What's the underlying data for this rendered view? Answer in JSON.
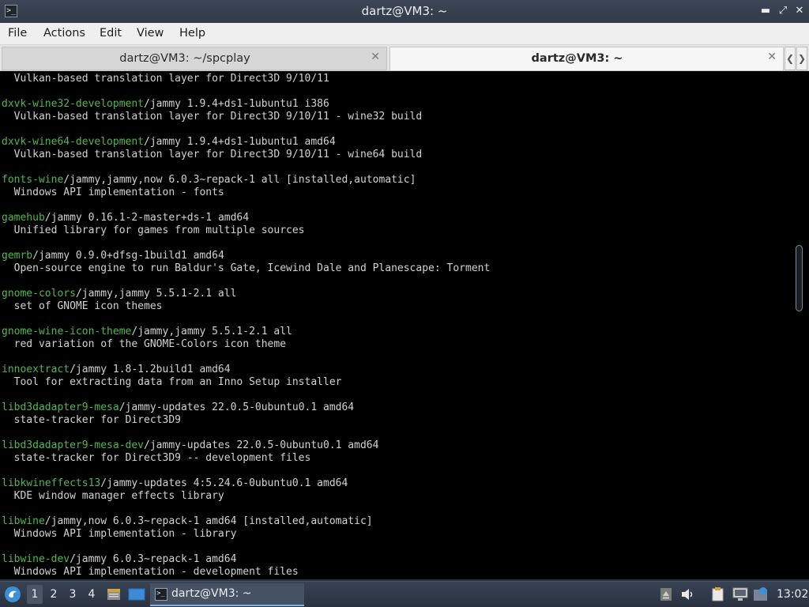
{
  "window": {
    "title": "dartz@VM3: ~",
    "app_icon_glyph": ">_",
    "buttons": {
      "minimize": "▬",
      "maximize": "⤢",
      "close": "✕"
    }
  },
  "menu": [
    "File",
    "Actions",
    "Edit",
    "View",
    "Help"
  ],
  "tabs": [
    {
      "label": "dartz@VM3: ~/spcplay",
      "active": false
    },
    {
      "label": "dartz@VM3: ~",
      "active": true
    }
  ],
  "tab_close_glyph": "✕",
  "tab_nav": {
    "prev": "❮",
    "next": "❯"
  },
  "terminal_lines": [
    {
      "pkg": "",
      "rest": "  Vulkan-based translation layer for Direct3D 9/10/11"
    },
    {
      "pkg": "",
      "rest": ""
    },
    {
      "pkg": "dxvk-wine32-development",
      "rest": "/jammy 1.9.4+ds1-1ubuntu1 i386"
    },
    {
      "pkg": "",
      "rest": "  Vulkan-based translation layer for Direct3D 9/10/11 - wine32 build"
    },
    {
      "pkg": "",
      "rest": ""
    },
    {
      "pkg": "dxvk-wine64-development",
      "rest": "/jammy 1.9.4+ds1-1ubuntu1 amd64"
    },
    {
      "pkg": "",
      "rest": "  Vulkan-based translation layer for Direct3D 9/10/11 - wine64 build"
    },
    {
      "pkg": "",
      "rest": ""
    },
    {
      "pkg": "fonts-wine",
      "rest": "/jammy,jammy,now 6.0.3~repack-1 all [installed,automatic]"
    },
    {
      "pkg": "",
      "rest": "  Windows API implementation - fonts"
    },
    {
      "pkg": "",
      "rest": ""
    },
    {
      "pkg": "gamehub",
      "rest": "/jammy 0.16.1-2-master+ds-1 amd64"
    },
    {
      "pkg": "",
      "rest": "  Unified library for games from multiple sources"
    },
    {
      "pkg": "",
      "rest": ""
    },
    {
      "pkg": "gemrb",
      "rest": "/jammy 0.9.0+dfsg-1build1 amd64"
    },
    {
      "pkg": "",
      "rest": "  Open-source engine to run Baldur's Gate, Icewind Dale and Planescape: Torment"
    },
    {
      "pkg": "",
      "rest": ""
    },
    {
      "pkg": "gnome-colors",
      "rest": "/jammy,jammy 5.5.1-2.1 all"
    },
    {
      "pkg": "",
      "rest": "  set of GNOME icon themes"
    },
    {
      "pkg": "",
      "rest": ""
    },
    {
      "pkg": "gnome-wine-icon-theme",
      "rest": "/jammy,jammy 5.5.1-2.1 all"
    },
    {
      "pkg": "",
      "rest": "  red variation of the GNOME-Colors icon theme"
    },
    {
      "pkg": "",
      "rest": ""
    },
    {
      "pkg": "innoextract",
      "rest": "/jammy 1.8-1.2build1 amd64"
    },
    {
      "pkg": "",
      "rest": "  Tool for extracting data from an Inno Setup installer"
    },
    {
      "pkg": "",
      "rest": ""
    },
    {
      "pkg": "libd3dadapter9-mesa",
      "rest": "/jammy-updates 22.0.5-0ubuntu0.1 amd64"
    },
    {
      "pkg": "",
      "rest": "  state-tracker for Direct3D9"
    },
    {
      "pkg": "",
      "rest": ""
    },
    {
      "pkg": "libd3dadapter9-mesa-dev",
      "rest": "/jammy-updates 22.0.5-0ubuntu0.1 amd64"
    },
    {
      "pkg": "",
      "rest": "  state-tracker for Direct3D9 -- development files"
    },
    {
      "pkg": "",
      "rest": ""
    },
    {
      "pkg": "libkwineffects13",
      "rest": "/jammy-updates 4:5.24.6-0ubuntu0.1 amd64"
    },
    {
      "pkg": "",
      "rest": "  KDE window manager effects library"
    },
    {
      "pkg": "",
      "rest": ""
    },
    {
      "pkg": "libwine",
      "rest": "/jammy,now 6.0.3~repack-1 amd64 [installed,automatic]"
    },
    {
      "pkg": "",
      "rest": "  Windows API implementation - library"
    },
    {
      "pkg": "",
      "rest": ""
    },
    {
      "pkg": "libwine-dev",
      "rest": "/jammy 6.0.3~repack-1 amd64"
    },
    {
      "pkg": "",
      "rest": "  Windows API implementation - development files"
    }
  ],
  "colors": {
    "terminal_bg": "#000000",
    "terminal_fg": "#d2d2d2",
    "package_name": "#4fb74f",
    "task_accent": "#7fb1e3"
  },
  "taskbar": {
    "workspaces": [
      "1",
      "2",
      "3",
      "4"
    ],
    "active_workspace": "1",
    "task_label": "dartz@VM3: ~",
    "clock": "13:02",
    "icons": [
      "start-menu-icon",
      "file-manager-icon",
      "show-desktop-icon",
      "terminal-icon",
      "eject-icon",
      "volume-icon",
      "clipboard-icon",
      "network-icon",
      "updates-icon"
    ]
  }
}
